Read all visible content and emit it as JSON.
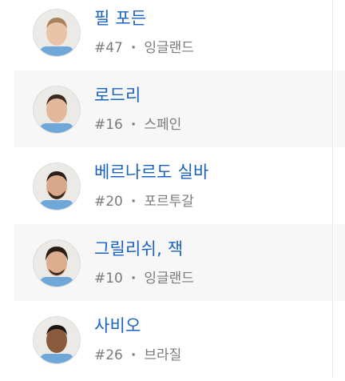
{
  "players": [
    {
      "name": "필 포든",
      "number": "#47",
      "nation": "잉글랜드",
      "skin": "#e9c4a8",
      "hair": "#a8825a",
      "alt": false
    },
    {
      "name": "로드리",
      "number": "#16",
      "nation": "스페인",
      "skin": "#e3b79a",
      "hair": "#3a2a20",
      "alt": true
    },
    {
      "name": "베르나르도 실바",
      "number": "#20",
      "nation": "포르투갈",
      "skin": "#d7a98a",
      "hair": "#2b1f18",
      "alt": false
    },
    {
      "name": "그릴리쉬, 잭",
      "number": "#10",
      "nation": "잉글랜드",
      "skin": "#dcae8e",
      "hair": "#2a1d15",
      "alt": true
    },
    {
      "name": "사비오",
      "number": "#26",
      "nation": "브라질",
      "skin": "#8a5a3c",
      "hair": "#1a1410",
      "alt": false
    }
  ],
  "separator": "·"
}
